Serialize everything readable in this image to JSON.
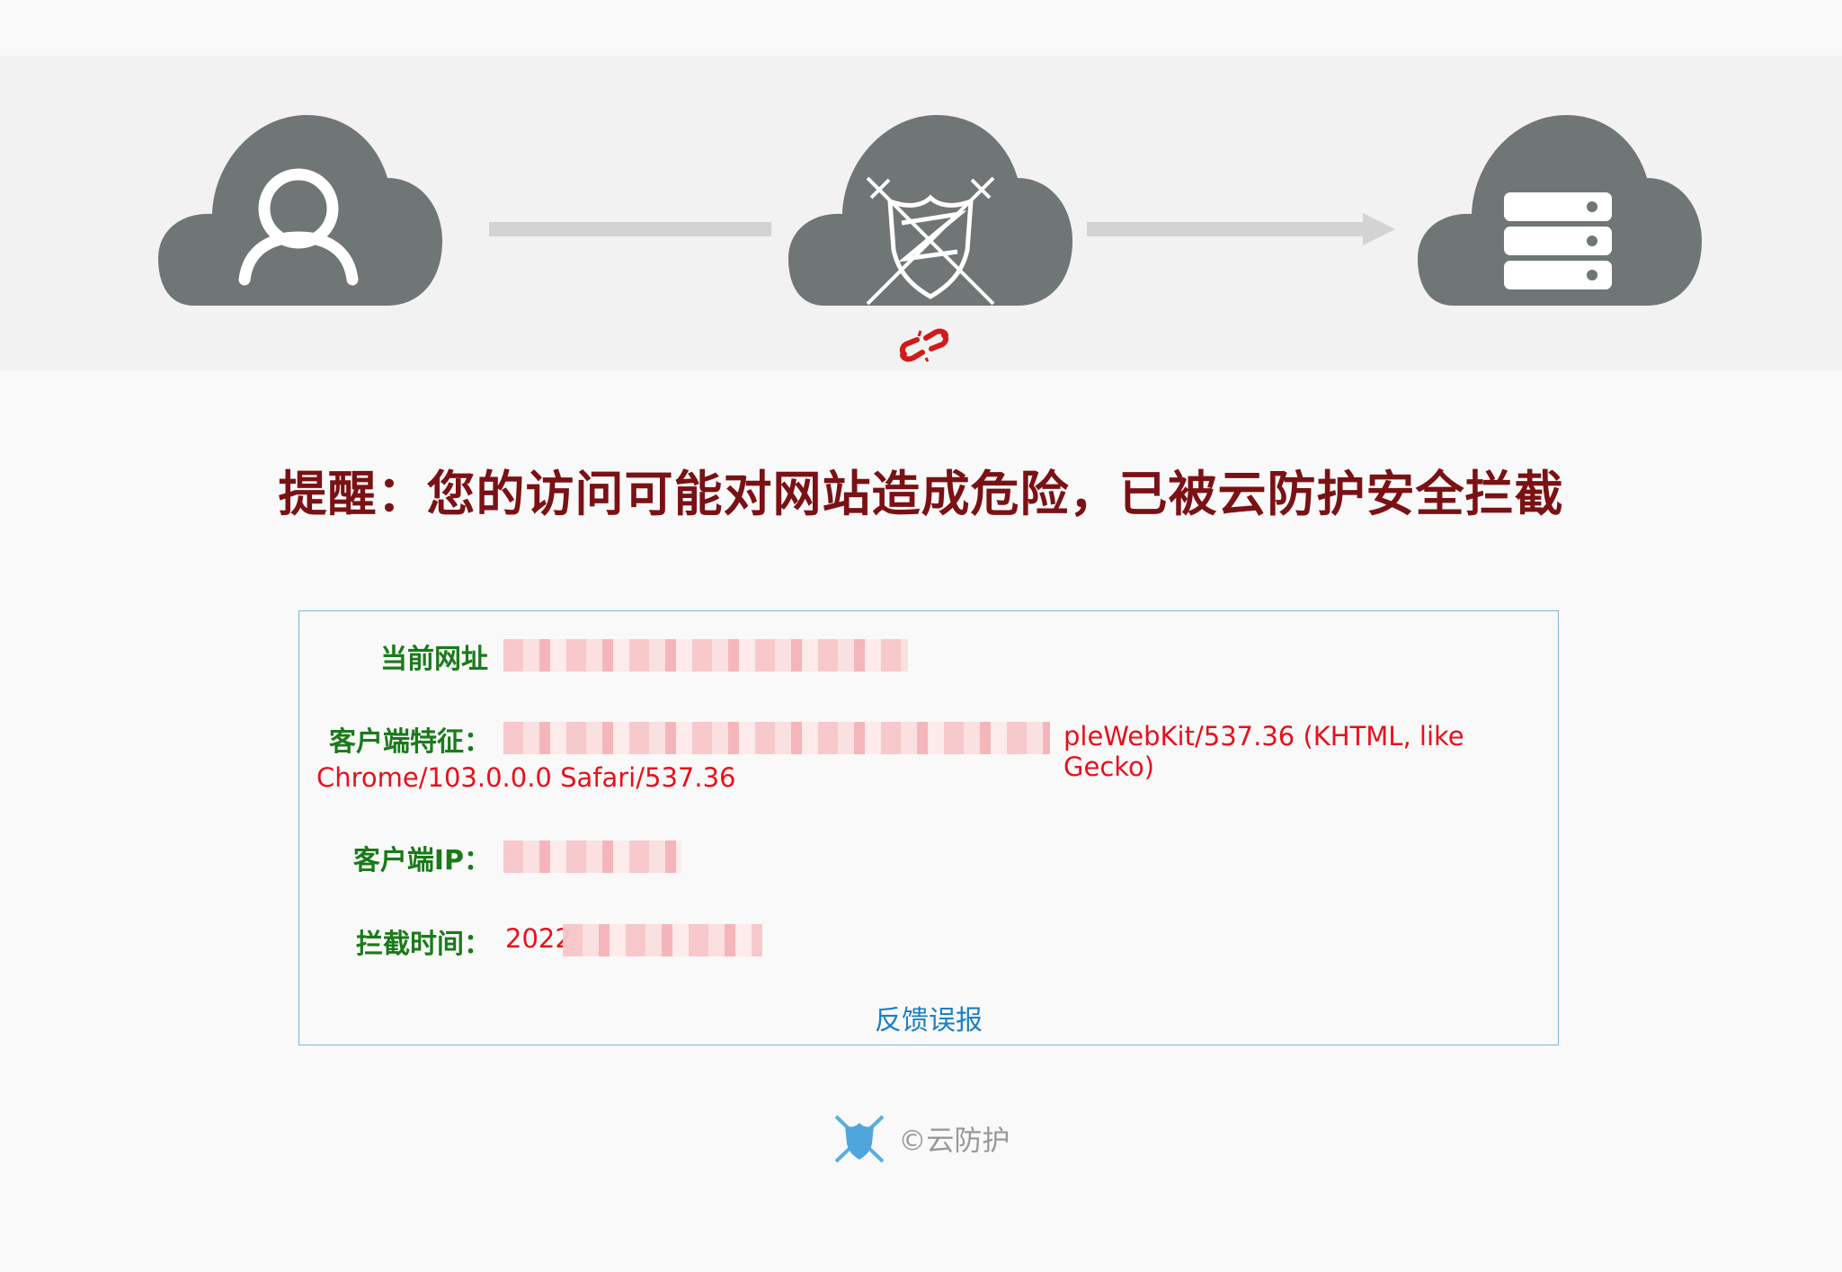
{
  "banner": {
    "icons": [
      "user-cloud-icon",
      "shield-swords-cloud-icon",
      "server-cloud-icon",
      "broken-link-icon"
    ],
    "cloud_color": "#6f7675",
    "line_color": "#d3d3d3"
  },
  "title": "提醒：您的访问可能对网站造成危险，已被云防护安全拦截",
  "info": {
    "url_label": "当前网址",
    "ua_label": "客户端特征：",
    "ua_value_visible": "pleWebKit/537.36 (KHTML, like Gecko)",
    "ua_value_line2": "Chrome/103.0.0.0 Safari/537.36",
    "ip_label": "客户端IP：",
    "time_label": "拦截时间：",
    "time_value_visible": "2022",
    "feedback": "反馈误报"
  },
  "footer": {
    "text": "©云防护",
    "icon": "shield-logo-icon"
  },
  "colors": {
    "title": "#7a1114",
    "label": "#1a7a1a",
    "value": "#e8101a",
    "link": "#1d7fc4",
    "border": "#7fb5d5"
  }
}
